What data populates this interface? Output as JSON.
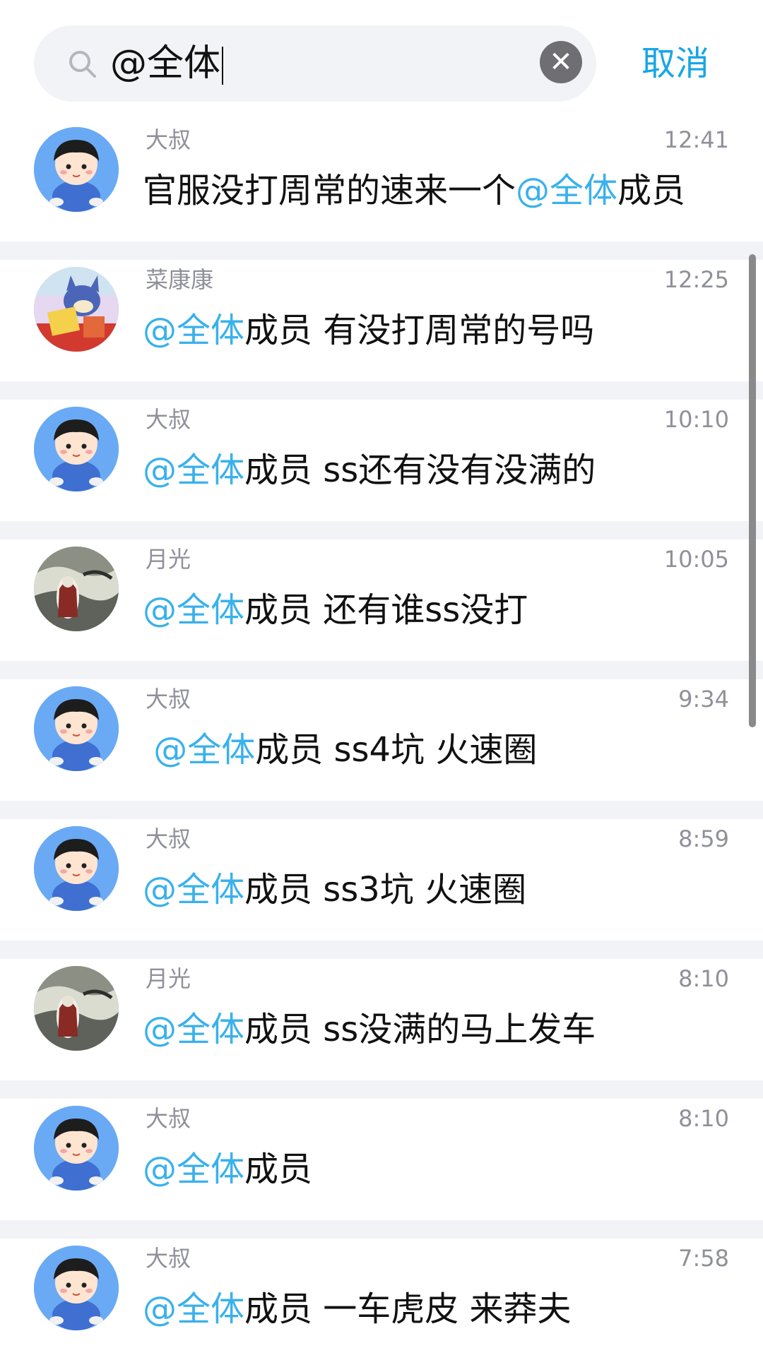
{
  "search": {
    "query": "@全体",
    "cancel_label": "取消"
  },
  "mention_text": "@全体",
  "results": [
    {
      "name": "大叔",
      "time": "12:41",
      "prefix": "官服没打周常的速来一个",
      "rest": "成员",
      "avatar": "boy"
    },
    {
      "name": "菜康康",
      "time": "12:25",
      "prefix": "",
      "rest": "成员 有没打周常的号吗",
      "avatar": "cartoon"
    },
    {
      "name": "大叔",
      "time": "10:10",
      "prefix": "",
      "rest": "成员 ss还有没有没满的",
      "avatar": "boy"
    },
    {
      "name": "月光",
      "time": "10:05",
      "prefix": "",
      "rest": "成员 还有谁ss没打",
      "avatar": "painting"
    },
    {
      "name": "大叔",
      "time": "9:34",
      "prefix": " ",
      "rest": "成员 ss4坑 火速圈",
      "avatar": "boy"
    },
    {
      "name": "大叔",
      "time": "8:59",
      "prefix": "",
      "rest": "成员 ss3坑 火速圈",
      "avatar": "boy"
    },
    {
      "name": "月光",
      "time": "8:10",
      "prefix": "",
      "rest": "成员 ss没满的马上发车",
      "avatar": "painting"
    },
    {
      "name": "大叔",
      "time": "8:10",
      "prefix": "",
      "rest": "成员",
      "avatar": "boy"
    },
    {
      "name": "大叔",
      "time": "7:58",
      "prefix": "",
      "rest": "成员 一车虎皮 来莽夫",
      "avatar": "boy"
    }
  ]
}
